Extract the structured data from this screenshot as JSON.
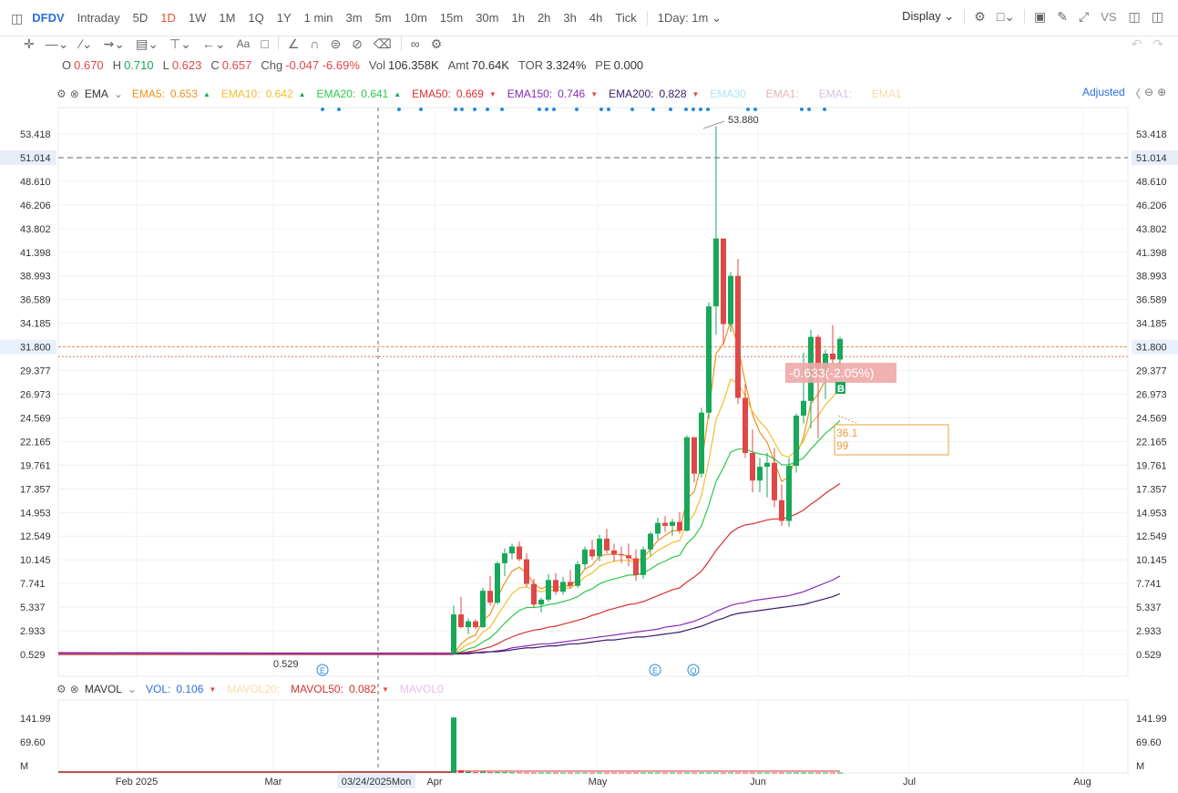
{
  "toolbar": {
    "symbol": "DFDV",
    "periods": [
      "Intraday",
      "5D",
      "1D",
      "1W",
      "1M",
      "1Q",
      "1Y",
      "1 min",
      "3m",
      "5m",
      "10m",
      "15m",
      "30m",
      "1h",
      "2h",
      "3h",
      "4h",
      "Tick"
    ],
    "active_period": "1D",
    "interval_select": "1Day: 1m",
    "display_label": "Display",
    "vs_label": "VS"
  },
  "ohlc": {
    "o_label": "O",
    "o": "0.670",
    "h_label": "H",
    "h": "0.710",
    "l_label": "L",
    "l": "0.623",
    "c_label": "C",
    "c": "0.657",
    "chg_label": "Chg",
    "chg": "-0.047",
    "chg_pct": "-6.69%",
    "vol_label": "Vol",
    "vol": "106.358K",
    "amt_label": "Amt",
    "amt": "70.64K",
    "tor_label": "TOR",
    "tor": "3.324%",
    "pe_label": "PE",
    "pe": "0.000"
  },
  "ema_legend": {
    "name": "EMA",
    "items": [
      {
        "label": "EMA5:",
        "value": "0.653",
        "color": "#f0901e",
        "arrow": "up"
      },
      {
        "label": "EMA10:",
        "value": "0.642",
        "color": "#f0c030",
        "arrow": "up"
      },
      {
        "label": "EMA20:",
        "value": "0.641",
        "color": "#2cc84a",
        "arrow": "up"
      },
      {
        "label": "EMA50:",
        "value": "0.669",
        "color": "#d83030",
        "arrow": "down"
      },
      {
        "label": "EMA150:",
        "value": "0.746",
        "color": "#8a2ab8",
        "arrow": "down"
      },
      {
        "label": "EMA200:",
        "value": "0.828",
        "color": "#3a1a6a",
        "arrow": "down"
      }
    ],
    "faded": [
      {
        "label": "EMA30",
        "color": "#aee6ef"
      },
      {
        "label": "EMA1:",
        "color": "#e2b8bb"
      },
      {
        "label": "EMA1:",
        "color": "#d4c0e6"
      },
      {
        "label": "EMA1",
        "color": "#f5dcb0"
      }
    ],
    "adjusted": "Adjusted"
  },
  "vol_legend": {
    "name": "MAVOL",
    "items": [
      {
        "label": "VOL:",
        "value": "0.106",
        "color": "#2a6fdb",
        "arrow": "down"
      },
      {
        "label": "MAVOL20:",
        "value": "",
        "color": "#f5dcb0",
        "arrow": ""
      },
      {
        "label": "MAVOL50:",
        "value": "0.082",
        "color": "#d83030",
        "arrow": "down"
      },
      {
        "label": "MAVOL0",
        "value": "",
        "color": "#e6c0e6",
        "arrow": ""
      }
    ]
  },
  "colors": {
    "up": "#18a85a",
    "down": "#e04848",
    "crosshair_tag": "#e8eef8",
    "price_tag": "#e8f0fb"
  },
  "chart_data": {
    "type": "candlestick",
    "price_axis_ticks": [
      "53.418",
      "51.014",
      "48.610",
      "46.206",
      "43.802",
      "41.398",
      "38.993",
      "36.589",
      "34.185",
      "31.800",
      "29.377",
      "26.973",
      "24.569",
      "22.165",
      "19.761",
      "17.357",
      "14.953",
      "12.549",
      "10.145",
      "7.741",
      "5.337",
      "2.933",
      "0.529"
    ],
    "ylim": [
      0.529,
      53.418
    ],
    "crosshair_price": "51.014",
    "last_price_tag": "31.800",
    "x_ticks": [
      "Feb 2025",
      "Mar",
      "Apr",
      "May",
      "Jun",
      "Jul",
      "Aug"
    ],
    "crosshair_date": "03/24/2025Mon",
    "high_label": "53.880",
    "low_label": "0.529",
    "floating_change": "-0.633(-2.05%)",
    "tooltip_lines": [
      "36.1",
      "99"
    ],
    "trade_marker": "B",
    "event_markers": [
      "E",
      "E",
      "Q"
    ],
    "series": [
      {
        "name": "EMA5",
        "color": "#f0901e"
      },
      {
        "name": "EMA10",
        "color": "#f0c030"
      },
      {
        "name": "EMA20",
        "color": "#2cc84a"
      },
      {
        "name": "EMA50",
        "color": "#d83030"
      },
      {
        "name": "EMA150",
        "color": "#8a2ab8"
      },
      {
        "name": "EMA200",
        "color": "#3a1a6a"
      }
    ],
    "candles": [
      [
        0.6,
        5.5,
        0.6,
        4.6
      ],
      [
        4.6,
        6.4,
        3.2,
        3.3
      ],
      [
        3.3,
        4.2,
        2.6,
        3.9
      ],
      [
        3.9,
        4.1,
        3.1,
        3.3
      ],
      [
        3.3,
        7.3,
        3.2,
        7.0
      ],
      [
        7.0,
        8.5,
        5.5,
        5.8
      ],
      [
        5.8,
        10.0,
        5.6,
        9.8
      ],
      [
        9.8,
        11.3,
        8.5,
        10.8
      ],
      [
        10.8,
        11.8,
        10.2,
        11.5
      ],
      [
        11.5,
        12.0,
        10.0,
        10.2
      ],
      [
        10.2,
        10.8,
        7.4,
        7.7
      ],
      [
        7.7,
        8.2,
        5.3,
        5.6
      ],
      [
        5.6,
        6.3,
        4.8,
        6.1
      ],
      [
        6.1,
        8.7,
        5.9,
        8.1
      ],
      [
        8.1,
        8.8,
        6.6,
        6.9
      ],
      [
        6.9,
        8.4,
        6.6,
        7.9
      ],
      [
        7.9,
        9.1,
        7.2,
        7.5
      ],
      [
        7.5,
        10.0,
        7.3,
        9.7
      ],
      [
        9.7,
        11.5,
        9.2,
        11.2
      ],
      [
        11.2,
        12.2,
        10.2,
        10.5
      ],
      [
        10.5,
        12.7,
        10.0,
        12.3
      ],
      [
        12.3,
        13.3,
        10.8,
        11.1
      ],
      [
        11.1,
        11.8,
        10.0,
        10.7
      ],
      [
        10.7,
        11.5,
        9.8,
        10.6
      ],
      [
        10.6,
        11.8,
        9.5,
        10.3
      ],
      [
        10.3,
        11.2,
        8.0,
        8.6
      ],
      [
        8.6,
        11.5,
        8.2,
        11.2
      ],
      [
        11.2,
        13.0,
        10.5,
        12.8
      ],
      [
        12.8,
        14.4,
        12.2,
        13.9
      ],
      [
        13.9,
        14.6,
        13.0,
        13.6
      ],
      [
        13.6,
        14.3,
        12.6,
        14.0
      ],
      [
        14.0,
        15.0,
        12.8,
        13.1
      ],
      [
        13.1,
        22.8,
        13.0,
        22.6
      ],
      [
        22.6,
        21.0,
        18.0,
        18.9
      ],
      [
        18.9,
        25.6,
        18.5,
        25.1
      ],
      [
        25.1,
        36.3,
        24.5,
        35.9
      ],
      [
        35.9,
        54.2,
        33.0,
        42.8
      ],
      [
        42.8,
        36.0,
        32.0,
        34.1
      ],
      [
        34.1,
        39.4,
        33.3,
        39.0
      ],
      [
        39.0,
        40.7,
        26.0,
        26.6
      ],
      [
        26.6,
        28.0,
        20.5,
        21.0
      ],
      [
        21.0,
        23.4,
        17.0,
        18.2
      ],
      [
        18.2,
        20.5,
        17.0,
        19.6
      ],
      [
        19.6,
        21.0,
        16.5,
        20.0
      ],
      [
        20.0,
        21.5,
        15.5,
        16.2
      ],
      [
        16.2,
        17.8,
        13.6,
        14.1
      ],
      [
        14.1,
        20.5,
        13.5,
        19.7
      ],
      [
        19.7,
        25.0,
        19.0,
        24.8
      ],
      [
        24.8,
        31.2,
        24.0,
        26.3
      ],
      [
        26.3,
        33.5,
        23.5,
        32.8
      ],
      [
        32.8,
        33.0,
        22.5,
        28.9
      ],
      [
        28.9,
        31.5,
        26.5,
        31.1
      ],
      [
        31.1,
        34.0,
        30.0,
        30.5
      ],
      [
        30.5,
        32.8,
        28.7,
        32.6
      ]
    ],
    "ema5": [
      0.6,
      1.6,
      2.2,
      2.5,
      4.0,
      4.6,
      6.3,
      7.8,
      9.0,
      9.4,
      8.8,
      7.7,
      7.2,
      7.5,
      7.3,
      7.5,
      7.5,
      8.2,
      9.2,
      9.6,
      10.5,
      10.7,
      10.7,
      10.7,
      10.5,
      9.9,
      10.4,
      11.2,
      12.1,
      12.6,
      13.1,
      13.1,
      16.3,
      17.1,
      19.8,
      25.2,
      31.1,
      32.1,
      34.4,
      31.8,
      28.2,
      24.9,
      23.1,
      22.1,
      20.1,
      18.1,
      18.6,
      20.7,
      22.6,
      26.0,
      27.0,
      28.4,
      29.1,
      30.3
    ],
    "ema10": [
      0.6,
      1.1,
      1.6,
      1.9,
      2.8,
      3.3,
      4.5,
      5.6,
      6.7,
      7.3,
      7.4,
      7.1,
      6.9,
      7.1,
      7.0,
      7.2,
      7.3,
      7.7,
      8.4,
      8.8,
      9.5,
      9.8,
      10.0,
      10.1,
      10.1,
      9.8,
      10.0,
      10.5,
      11.1,
      11.5,
      11.9,
      12.1,
      13.9,
      14.8,
      16.7,
      20.2,
      24.4,
      26.2,
      28.5,
      28.1,
      26.8,
      25.2,
      24.2,
      23.4,
      22.1,
      20.8,
      20.6,
      21.3,
      22.2,
      24.0,
      24.8,
      25.9,
      26.7,
      27.7
    ],
    "ema20": [
      0.6,
      0.8,
      1.1,
      1.3,
      1.8,
      2.2,
      2.9,
      3.7,
      4.4,
      5.0,
      5.3,
      5.3,
      5.4,
      5.6,
      5.7,
      5.9,
      6.1,
      6.4,
      6.9,
      7.2,
      7.7,
      8.0,
      8.2,
      8.4,
      8.6,
      8.6,
      8.8,
      9.2,
      9.7,
      10.0,
      10.4,
      10.6,
      11.8,
      12.5,
      13.6,
      15.7,
      18.1,
      19.5,
      21.1,
      21.4,
      21.4,
      21.1,
      20.9,
      20.8,
      20.4,
      19.8,
      19.8,
      20.1,
      20.5,
      21.4,
      22.2,
      23.0,
      23.6,
      24.3
    ],
    "ema50": [
      0.6,
      0.7,
      0.8,
      0.9,
      1.1,
      1.3,
      1.6,
      2.0,
      2.3,
      2.6,
      2.8,
      3.0,
      3.1,
      3.3,
      3.4,
      3.6,
      3.8,
      4.0,
      4.2,
      4.5,
      4.7,
      5.0,
      5.2,
      5.4,
      5.6,
      5.7,
      5.9,
      6.2,
      6.5,
      6.8,
      7.1,
      7.3,
      7.9,
      8.4,
      9.0,
      10.0,
      11.1,
      12.0,
      12.9,
      13.4,
      13.7,
      13.8,
      14.0,
      14.2,
      14.3,
      14.3,
      14.5,
      14.8,
      15.2,
      15.8,
      16.3,
      16.9,
      17.4,
      17.9
    ],
    "ema150": [
      0.6,
      0.6,
      0.7,
      0.7,
      0.8,
      0.8,
      0.9,
      1.0,
      1.2,
      1.3,
      1.4,
      1.5,
      1.6,
      1.6,
      1.7,
      1.8,
      1.9,
      2.0,
      2.1,
      2.2,
      2.3,
      2.4,
      2.5,
      2.6,
      2.7,
      2.8,
      2.9,
      3.0,
      3.1,
      3.3,
      3.4,
      3.5,
      3.7,
      3.9,
      4.2,
      4.5,
      4.9,
      5.2,
      5.5,
      5.7,
      5.8,
      6.0,
      6.1,
      6.2,
      6.3,
      6.4,
      6.5,
      6.7,
      6.9,
      7.2,
      7.5,
      7.8,
      8.1,
      8.5
    ],
    "ema200": [
      0.6,
      0.6,
      0.6,
      0.7,
      0.7,
      0.8,
      0.8,
      0.9,
      1.0,
      1.1,
      1.2,
      1.2,
      1.3,
      1.4,
      1.4,
      1.5,
      1.6,
      1.6,
      1.7,
      1.8,
      1.9,
      2.0,
      2.0,
      2.1,
      2.2,
      2.3,
      2.3,
      2.4,
      2.5,
      2.6,
      2.7,
      2.8,
      3.0,
      3.2,
      3.4,
      3.7,
      4.0,
      4.2,
      4.5,
      4.7,
      4.8,
      4.9,
      5.0,
      5.1,
      5.2,
      5.3,
      5.4,
      5.5,
      5.6,
      5.8,
      6.0,
      6.2,
      6.4,
      6.7
    ],
    "volume_axis_ticks": [
      "141.99",
      "69.60",
      "M"
    ],
    "volume": [
      144,
      7,
      3,
      2,
      3,
      2,
      2,
      2,
      1.5,
      1.5,
      1.2,
      1.2,
      1,
      1,
      1,
      1,
      1,
      1,
      1,
      1,
      1,
      1,
      1,
      1,
      1,
      1,
      1,
      1,
      1,
      1,
      1,
      1,
      1,
      1,
      1,
      1,
      1,
      1,
      1,
      1,
      1,
      1,
      1,
      1,
      1,
      1,
      1,
      1,
      1,
      1,
      1,
      1,
      1,
      1
    ]
  }
}
